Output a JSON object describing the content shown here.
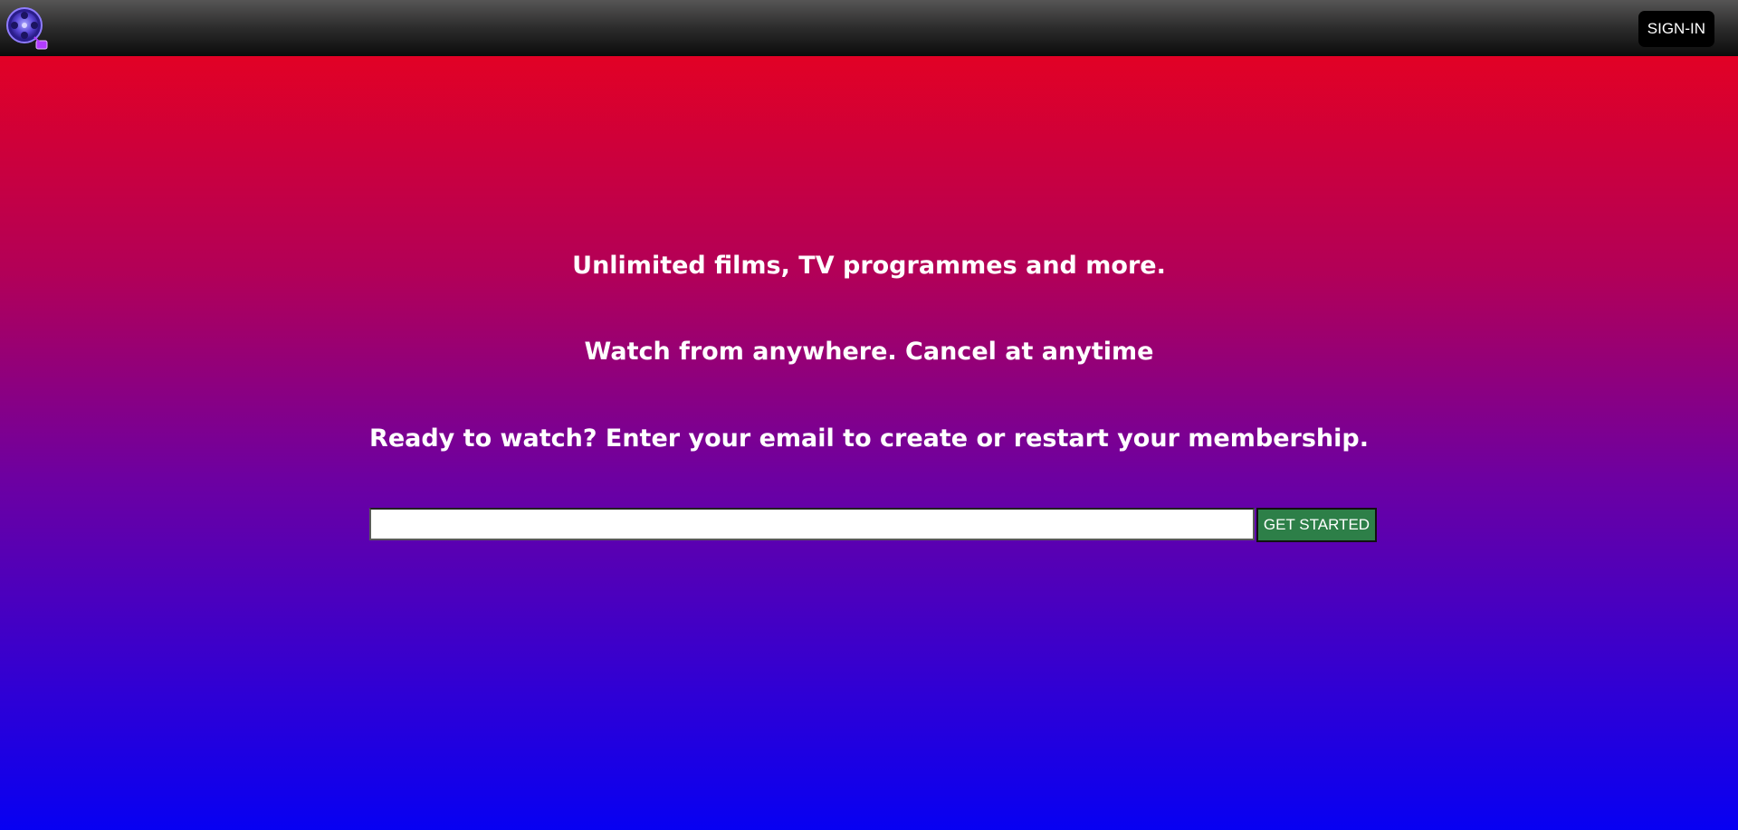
{
  "header": {
    "logo_icon": "film-reel-logo-icon",
    "signin_label": "SIGN-IN"
  },
  "hero": {
    "line1": "Unlimited films, TV programmes and more.",
    "line2": "Watch from anywhere. Cancel at anytime",
    "line3": "Ready to watch? Enter your email to create or restart your membership."
  },
  "signup": {
    "email_value": "",
    "email_placeholder": "",
    "button_label": "GET STARTED"
  },
  "colors": {
    "gradient_top": "#ee0118",
    "gradient_bottom": "#0700f2",
    "button_green": "#2d7f48",
    "topbar_dark": "#0b0b0b"
  }
}
